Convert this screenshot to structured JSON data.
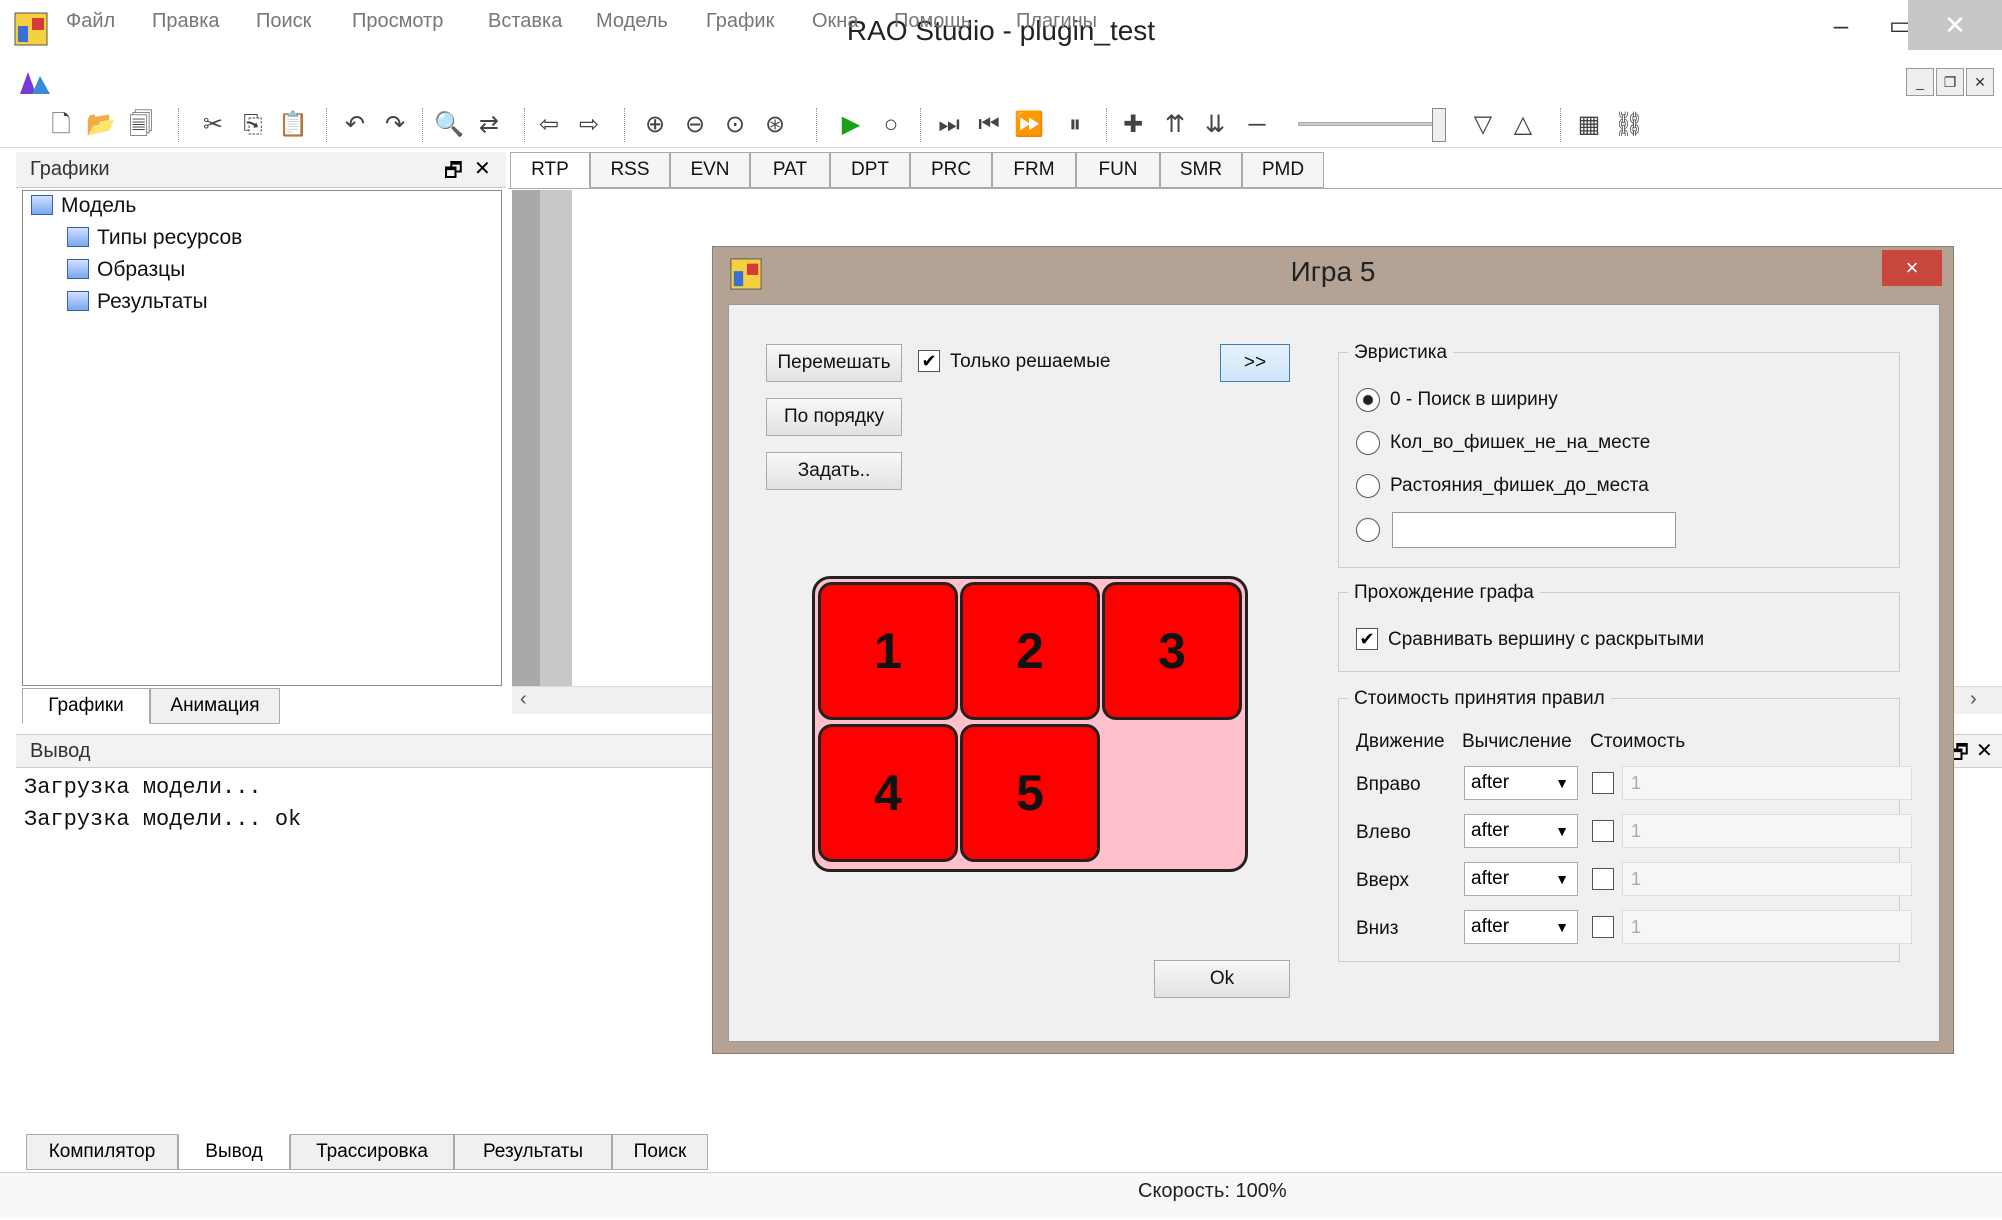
{
  "window": {
    "title": "RAO Studio - plugin_test"
  },
  "menu": [
    "Файл",
    "Правка",
    "Поиск",
    "Просмотр",
    "Вставка",
    "Модель",
    "График",
    "Окна",
    "Помощь",
    "Плагины"
  ],
  "left_panel": {
    "title": "Графики",
    "tree": {
      "root": "Модель",
      "children": [
        "Типы ресурсов",
        "Образцы",
        "Результаты"
      ]
    },
    "tabs": [
      "Графики",
      "Анимация"
    ]
  },
  "editor_tabs": [
    "RTP",
    "RSS",
    "EVN",
    "PAT",
    "DPT",
    "PRC",
    "FRM",
    "FUN",
    "SMR",
    "PMD"
  ],
  "output": {
    "title": "Вывод",
    "lines": [
      "Загрузка модели...",
      "Загрузка модели... ok"
    ]
  },
  "bottom_tabs": [
    "Компилятор",
    "Вывод",
    "Трассировка",
    "Результаты",
    "Поиск"
  ],
  "status": {
    "speed": "Скорость: 100%"
  },
  "dialog": {
    "title": "Игра 5",
    "close": "×",
    "btn_shuffle": "Перемешать",
    "btn_order": "По порядку",
    "btn_set": "Задать..",
    "chk_solvable": "Только решаемые",
    "btn_next": ">>",
    "btn_ok": "Ok",
    "tiles": [
      "1",
      "2",
      "3",
      "4",
      "5"
    ],
    "heuristic": {
      "title": "Эвристика",
      "options": [
        "0 - Поиск в ширину",
        "Кол_во_фишек_не_на_месте",
        "Растояния_фишек_до_места"
      ]
    },
    "graph": {
      "title": "Прохождение графа",
      "compare": "Сравнивать вершину с раскрытыми"
    },
    "cost": {
      "title": "Стоимость принятия правил",
      "headers": [
        "Движение",
        "Вычисление",
        "Стоимость"
      ],
      "rows": [
        {
          "move": "Вправо",
          "calc": "after",
          "cost": "1"
        },
        {
          "move": "Влево",
          "calc": "after",
          "cost": "1"
        },
        {
          "move": "Вверх",
          "calc": "after",
          "cost": "1"
        },
        {
          "move": "Вниз",
          "calc": "after",
          "cost": "1"
        }
      ]
    }
  }
}
